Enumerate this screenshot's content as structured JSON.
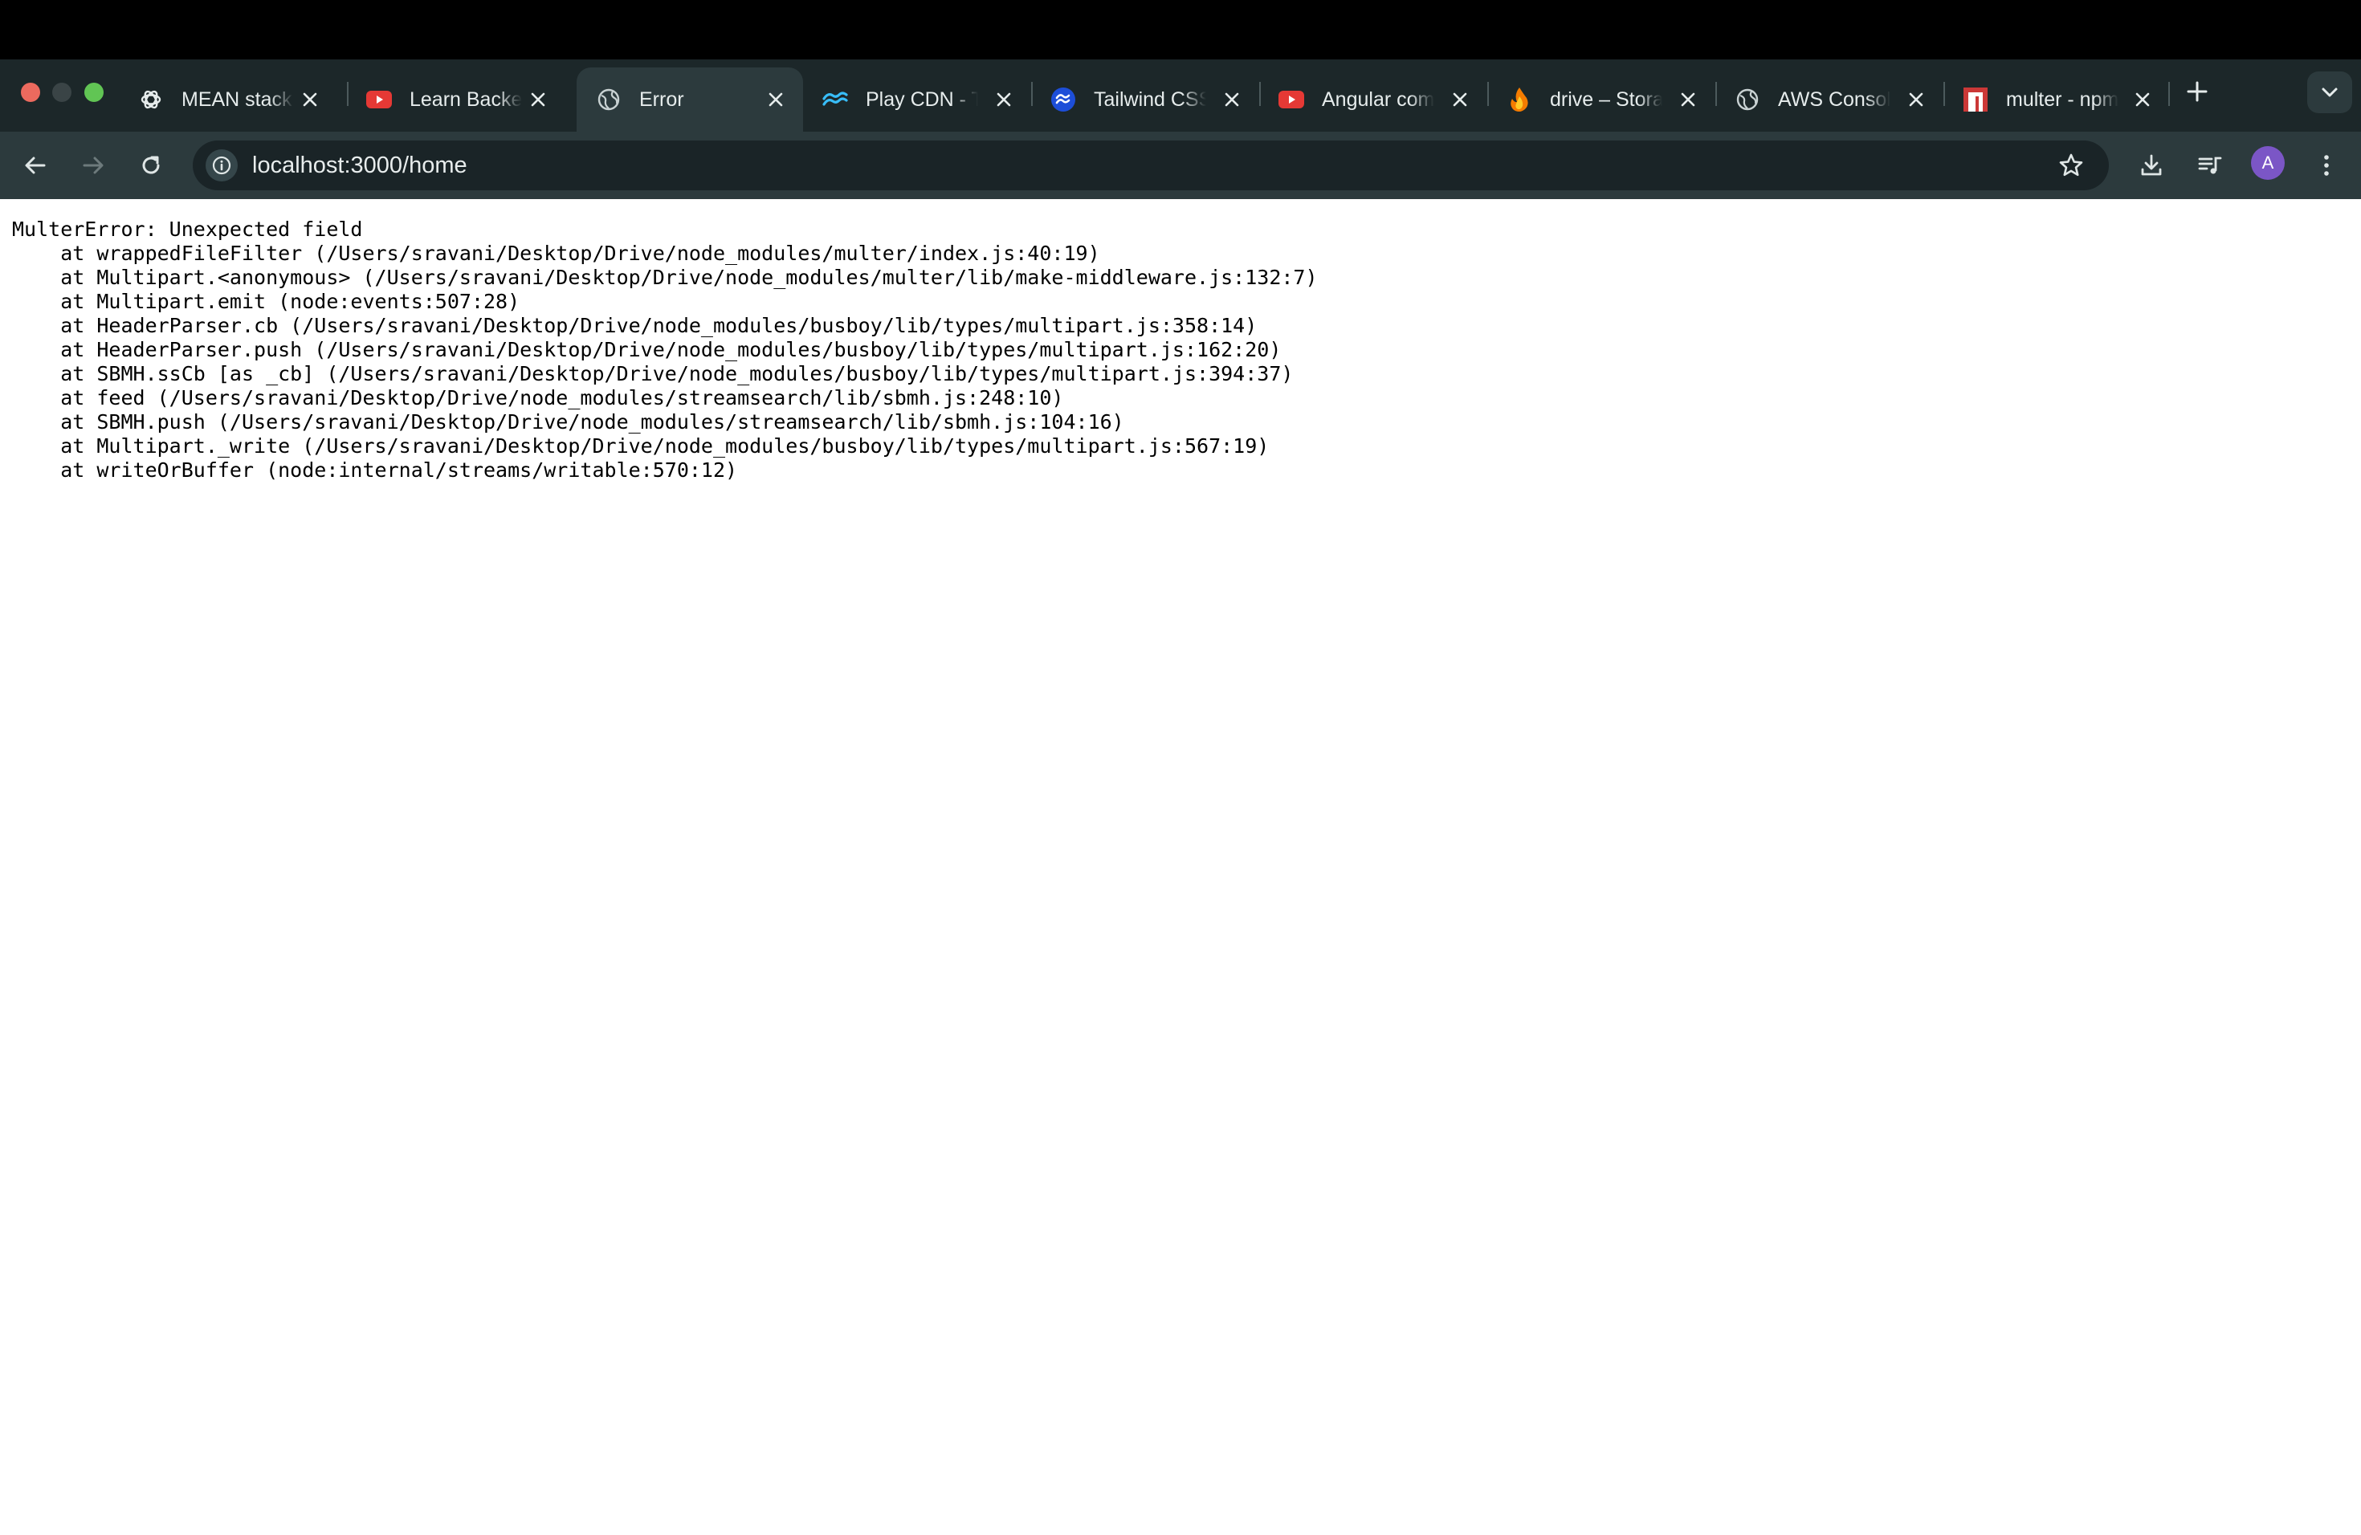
{
  "browser": {
    "tabs": [
      {
        "title": "MEAN stack",
        "favicon": "openai-icon"
      },
      {
        "title": "Learn Backend",
        "favicon": "youtube-icon"
      },
      {
        "title": "Error",
        "favicon": "globe-icon",
        "active": true
      },
      {
        "title": "Play CDN - Tailwind",
        "favicon": "tailwind-icon"
      },
      {
        "title": "Tailwind CSS",
        "favicon": "tailwind-blue-icon"
      },
      {
        "title": "Angular complete",
        "favicon": "youtube-icon"
      },
      {
        "title": "drive – Storage",
        "favicon": "firebase-icon"
      },
      {
        "title": "AWS Console",
        "favicon": "globe-icon"
      },
      {
        "title": "multer - npm",
        "favicon": "npm-icon"
      }
    ],
    "url": "localhost:3000/home",
    "profile_initial": "A",
    "colors": {
      "close_traffic": "#ec6a5e",
      "minimize_traffic": "#3a4446",
      "zoom_traffic": "#61c554",
      "avatar": "#7b56c6"
    }
  },
  "error": {
    "lines": [
      "MulterError: Unexpected field",
      "    at wrappedFileFilter (/Users/sravani/Desktop/Drive/node_modules/multer/index.js:40:19)",
      "    at Multipart.<anonymous> (/Users/sravani/Desktop/Drive/node_modules/multer/lib/make-middleware.js:132:7)",
      "    at Multipart.emit (node:events:507:28)",
      "    at HeaderParser.cb (/Users/sravani/Desktop/Drive/node_modules/busboy/lib/types/multipart.js:358:14)",
      "    at HeaderParser.push (/Users/sravani/Desktop/Drive/node_modules/busboy/lib/types/multipart.js:162:20)",
      "    at SBMH.ssCb [as _cb] (/Users/sravani/Desktop/Drive/node_modules/busboy/lib/types/multipart.js:394:37)",
      "    at feed (/Users/sravani/Desktop/Drive/node_modules/streamsearch/lib/sbmh.js:248:10)",
      "    at SBMH.push (/Users/sravani/Desktop/Drive/node_modules/streamsearch/lib/sbmh.js:104:16)",
      "    at Multipart._write (/Users/sravani/Desktop/Drive/node_modules/busboy/lib/types/multipart.js:567:19)",
      "    at writeOrBuffer (node:internal/streams/writable:570:12)"
    ]
  }
}
